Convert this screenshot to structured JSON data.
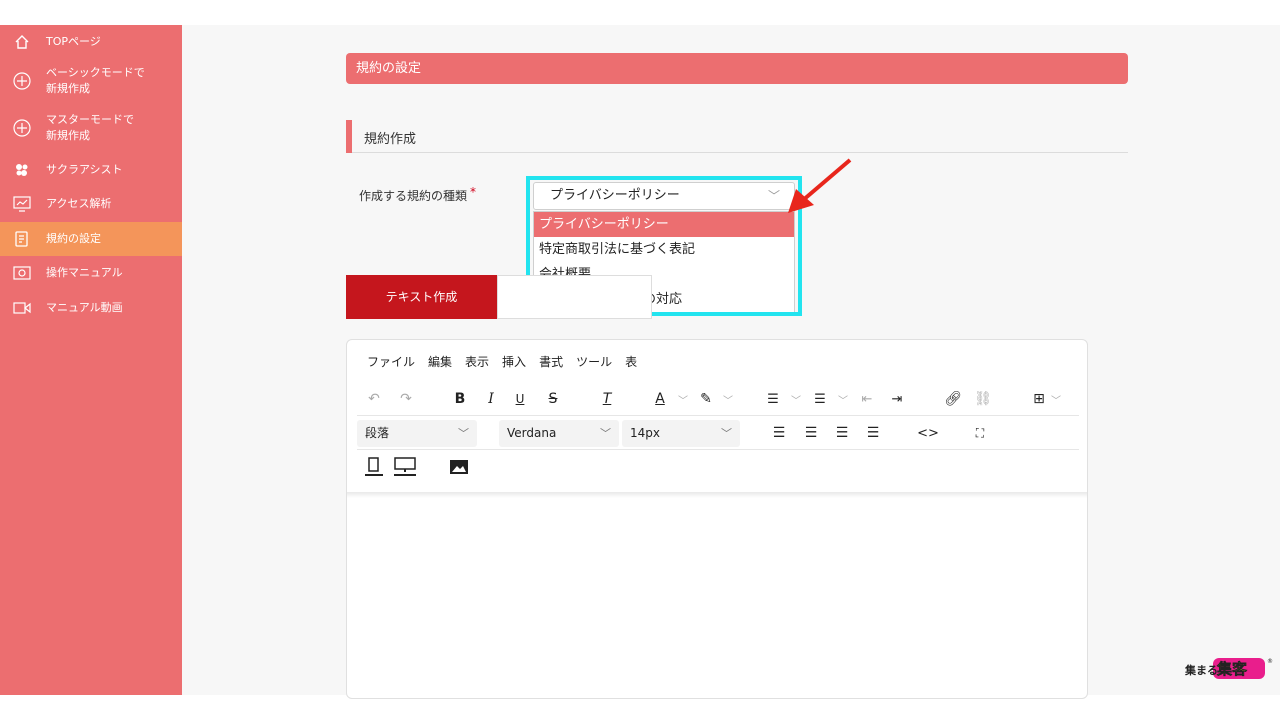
{
  "sidebar": {
    "items": [
      {
        "label": "TOPページ",
        "icon": "home-icon"
      },
      {
        "label": "ベーシックモードで\n新規作成",
        "icon": "plus-circle-icon"
      },
      {
        "label": "マスターモードで\n新規作成",
        "icon": "plus-circle-icon"
      },
      {
        "label": "サクラアシスト",
        "icon": "sakura-icon"
      },
      {
        "label": "アクセス解析",
        "icon": "chart-monitor-icon"
      },
      {
        "label": "規約の設定",
        "icon": "document-edit-icon"
      },
      {
        "label": "操作マニュアル",
        "icon": "manual-icon"
      },
      {
        "label": "マニュアル動画",
        "icon": "video-icon"
      }
    ],
    "active_index": 5,
    "color": "#ec6e70",
    "active_color": "#f4955a"
  },
  "page": {
    "header": "規約の設定",
    "section_title": "規約作成"
  },
  "form": {
    "field_label": "作成する規約の種類",
    "required_mark": "*",
    "selected_value": "プライバシーポリシー",
    "options": [
      "プライバシーポリシー",
      "特定商取引法に基づく表記",
      "会社概要",
      "特定電子メール法の対応"
    ]
  },
  "tabs": {
    "active_label": "テキスト作成"
  },
  "editor": {
    "menu": [
      "ファイル",
      "編集",
      "表示",
      "挿入",
      "書式",
      "ツール",
      "表"
    ],
    "block_format": "段落",
    "font_family": "Verdana",
    "font_size": "14px",
    "bold": "B",
    "italic": "I",
    "underline": "U",
    "strike": "S",
    "clear_format": "T",
    "text_color": "A"
  },
  "brand": {
    "accent": "#ec6e70",
    "tab_active": "#c5161d",
    "highlight": "#22e4ef",
    "arrow": "#e8261c",
    "logo_text": "集まる集客"
  }
}
